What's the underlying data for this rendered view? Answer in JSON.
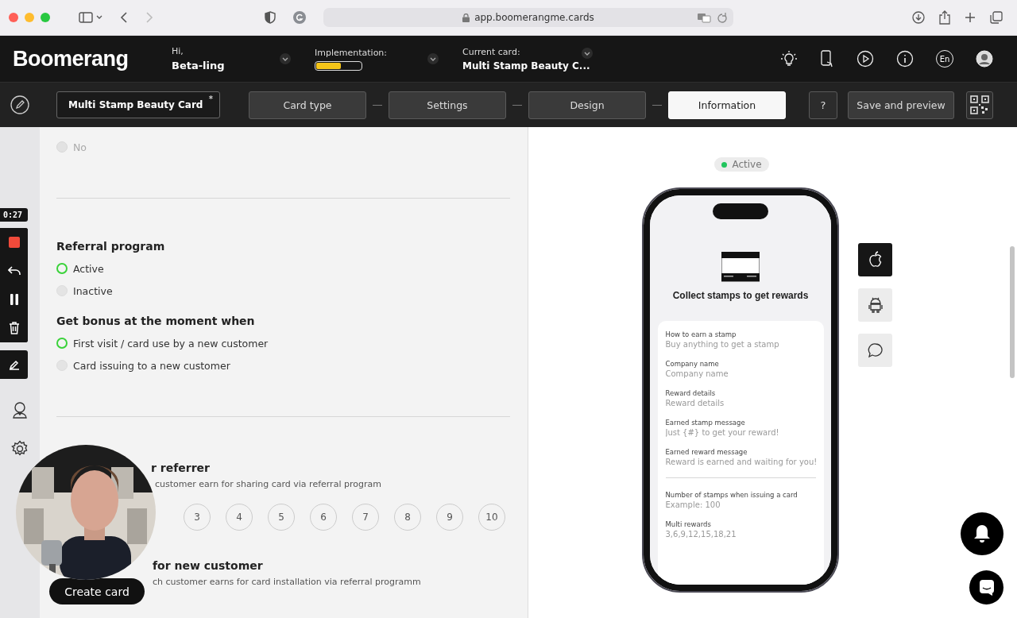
{
  "browser": {
    "url": "app.boomerangme.cards"
  },
  "header": {
    "logo": "Boomerang",
    "greeting": "Hi,",
    "user": "Beta-ling",
    "implementation": {
      "label": "Implementation:",
      "level": 0.55
    },
    "current_card": {
      "label": "Current card:",
      "value": "Multi Stamp Beauty C..."
    },
    "language": "En"
  },
  "toolbar": {
    "card_name": "Multi Stamp Beauty Card",
    "unsaved_mark": "*",
    "steps": [
      {
        "label": "Card type",
        "selected": false
      },
      {
        "label": "Settings",
        "selected": false
      },
      {
        "label": "Design",
        "selected": false
      },
      {
        "label": "Information",
        "selected": true
      }
    ],
    "help": "?",
    "save": "Save and preview"
  },
  "recorder": {
    "time": "0:27"
  },
  "form": {
    "previous_option": {
      "label": "No",
      "selected": false,
      "disabled": true
    },
    "sections": [
      {
        "title": "Referral program",
        "options": [
          {
            "label": "Active",
            "selected": true
          },
          {
            "label": "Inactive",
            "selected": false
          }
        ]
      },
      {
        "title": "Get bonus at the moment when",
        "options": [
          {
            "label": "First visit / card use by a new customer",
            "selected": true
          },
          {
            "label": "Card issuing to a new customer",
            "selected": false
          }
        ]
      }
    ],
    "reward_referrer": {
      "title": "r referrer",
      "description": "customer earn for sharing card via referral program",
      "choices": [
        {
          "label": "3",
          "selected": false
        },
        {
          "label": "4",
          "selected": false
        },
        {
          "label": "5",
          "selected": false
        },
        {
          "label": "6",
          "selected": false
        },
        {
          "label": "7",
          "selected": false
        },
        {
          "label": "8",
          "selected": false
        },
        {
          "label": "9",
          "selected": false
        },
        {
          "label": "10",
          "selected": false
        }
      ]
    },
    "reward_new_customer": {
      "title": "for new customer",
      "description": "ch customer earns for card installation via referral programm"
    },
    "create_button": "Create card"
  },
  "preview": {
    "status": "Active",
    "title": "Collect stamps to get rewards",
    "fields": [
      {
        "label": "How to earn a stamp",
        "placeholder": "Buy anything to get a stamp"
      },
      {
        "label": "Company name",
        "placeholder": "Company name"
      },
      {
        "label": "Reward details",
        "placeholder": "Reward details"
      },
      {
        "label": "Earned stamp message",
        "placeholder": "Just {#} to get your reward!"
      },
      {
        "label": "Earned reward message",
        "placeholder": "Reward is earned and waiting for you!"
      }
    ],
    "more_fields": [
      {
        "label": "Number of stamps when issuing a card",
        "placeholder": "Example: 100"
      },
      {
        "label": "Multi rewards",
        "placeholder": "3,6,9,12,15,18,21"
      }
    ],
    "platforms": [
      {
        "kind": "apple",
        "selected": true
      },
      {
        "kind": "android",
        "selected": false
      },
      {
        "kind": "chat",
        "selected": false
      }
    ]
  }
}
